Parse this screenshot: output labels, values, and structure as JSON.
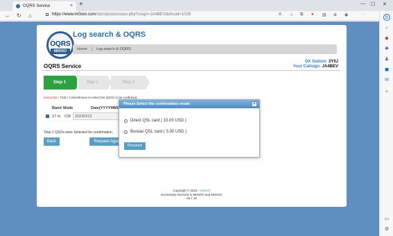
{
  "browser": {
    "tab_title": "OQRS Service",
    "url_host": "https://www.m0oxo.com",
    "url_path": "/oqrs/processqso.php?csign=JA4BEV&dxcall=1026",
    "new_tab": "+",
    "tab_close": "×"
  },
  "header": {
    "logo_text": "OQRS",
    "logo_sub": "M0OXO",
    "page_title": "Log search & OQRS",
    "breadcrumb": [
      "Home",
      "Log search & OQRS"
    ]
  },
  "service": {
    "title": "OQRS Service",
    "dx_label": "DX Station:",
    "dx_value": "3Y0J",
    "callsign_label": "Your Callsign:",
    "callsign_value": "JA4BEV"
  },
  "steps": [
    "Step 1",
    "Step 2",
    "Step 3"
  ],
  "instruction": {
    "prefix": "Instruction:",
    "text": "Tick(✓) checkboxes to select the QSOs to be confirmed."
  },
  "table": {
    "headers": [
      "Band",
      "Mode",
      "Date(YYYYMMDD)"
    ],
    "rows": [
      {
        "band": "17 m",
        "mode": "CW",
        "date": "20230213"
      }
    ]
  },
  "total_text": "Total 1 QSOs were Selected for confirmation.",
  "buttons": {
    "back": "Back",
    "request": "Request Again"
  },
  "modal": {
    "title": "Please Select the confirmation mode",
    "close": "×",
    "options": [
      "Direct QSL card ( 15.00 USD )",
      "Bureau QSL card ( 3.00 USD )"
    ],
    "proceed": "Proceed"
  },
  "footer": {
    "copyright": "Copyright © 2023 - ",
    "link": "HAVAO",
    "licensed": "Exclusively licensed to M0URX and M0OXO",
    "version": "v5.7.18"
  }
}
